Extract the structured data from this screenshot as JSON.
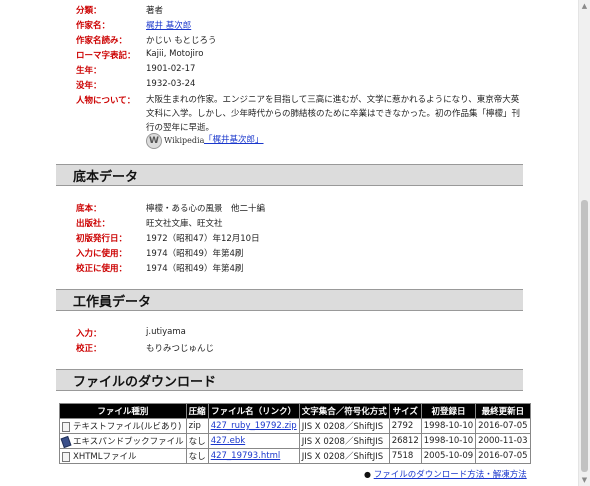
{
  "author": {
    "rows": [
      {
        "label": "分類：",
        "value": "著者"
      },
      {
        "label": "作家名：",
        "value": "梶井 基次郎"
      },
      {
        "label": "作家名読み：",
        "value": "かじい もとじろう"
      },
      {
        "label": "ローマ字表記：",
        "value": "Kajii, Motojiro"
      },
      {
        "label": "生年：",
        "value": "1901-02-17"
      },
      {
        "label": "没年：",
        "value": "1932-03-24"
      }
    ],
    "bio_label": "人物について：",
    "bio": "大阪生まれの作家。エンジニアを目指して三高に進むが、文学に惹かれるようになり、東京帝大英文科に入学。しかし、少年時代からの肺結核のために卒業はできなかった。初の作品集「檸檬」刊行の翌年に早逝。",
    "wikipedia_logo_text": "Wikipedia",
    "wikipedia_link": "「梶井基次郎」"
  },
  "source": {
    "heading": "底本データ",
    "rows": [
      {
        "label": "底本：",
        "value": "檸檬・ある心の風景　他二十編"
      },
      {
        "label": "出版社：",
        "value": "旺文社文庫、旺文社"
      },
      {
        "label": "初版発行日：",
        "value": "1972（昭和47）年12月10日"
      },
      {
        "label": "入力に使用：",
        "value": "1974（昭和49）年第4刷"
      },
      {
        "label": "校正に使用：",
        "value": "1974（昭和49）年第4刷"
      }
    ]
  },
  "staff": {
    "heading": "工作員データ",
    "rows": [
      {
        "label": "入力：",
        "value": "j.utiyama"
      },
      {
        "label": "校正：",
        "value": "もりみつじゅんじ"
      }
    ]
  },
  "download": {
    "heading": "ファイルのダウンロード",
    "columns": [
      "ファイル種別",
      "圧縮",
      "ファイル名（リンク）",
      "文字集合／符号化方式",
      "サイズ",
      "初登録日",
      "最終更新日"
    ],
    "files": [
      {
        "icon": "text-file-icon",
        "type": "テキストファイル(ルビあり)",
        "compress": "zip",
        "name": "427_ruby_19792.zip",
        "encoding": "JIS X 0208／ShiftJIS",
        "size": "2792",
        "registered": "1998-10-10",
        "updated": "2016-07-05"
      },
      {
        "icon": "ebook-icon",
        "type": "エキスパンドブックファイル",
        "compress": "なし",
        "name": "427.ebk",
        "encoding": "JIS X 0208／ShiftJIS",
        "size": "26812",
        "registered": "1998-10-10",
        "updated": "2000-11-03"
      },
      {
        "icon": "html-file-icon",
        "type": "XHTMLファイル",
        "compress": "なし",
        "name": "427_19793.html",
        "encoding": "JIS X 0208／ShiftJIS",
        "size": "7518",
        "registered": "2005-10-09",
        "updated": "2016-07-05"
      }
    ],
    "howto_bullet": "●",
    "howto_link": "ファイルのダウンロード方法・解凍方法"
  }
}
